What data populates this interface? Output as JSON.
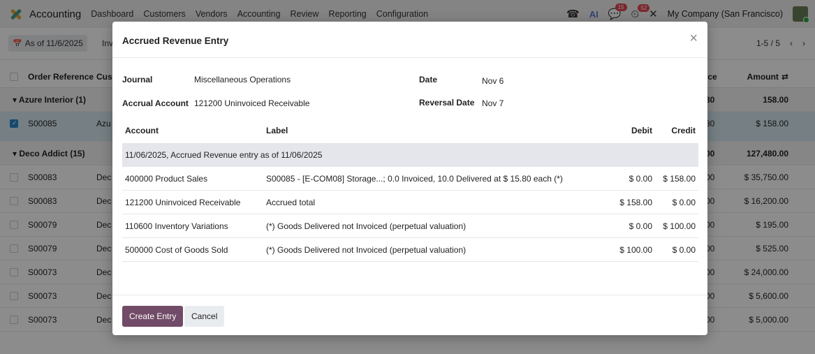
{
  "navbar": {
    "app_name": "Accounting",
    "menu": [
      "Dashboard",
      "Customers",
      "Vendors",
      "Accounting",
      "Review",
      "Reporting",
      "Configuration"
    ],
    "messages_badge": "15",
    "activity_badge": "52",
    "company": "My Company (San Francisco)"
  },
  "control": {
    "filter_label": "As of 11/6/2025",
    "inv_text": "Inv",
    "pager": "1-5 / 5"
  },
  "list": {
    "headers": {
      "order_reference": "Order Reference",
      "customer": "Cus",
      "price": "ice",
      "amount": "Amount"
    },
    "rows": [
      {
        "type": "group",
        "label": "Azure Interior (1)",
        "right": "80",
        "amount": "158.00"
      },
      {
        "type": "record",
        "ref": "S00085",
        "cust": "Azu",
        "right": "80",
        "amount": "$ 158.00",
        "selected": true
      },
      {
        "type": "group",
        "label": "Deco Addict (15)",
        "right": "00",
        "amount": "127,480.00"
      },
      {
        "type": "record",
        "ref": "S00083",
        "cust": "Dec",
        "right": "00",
        "amount": "$ 35,750.00"
      },
      {
        "type": "record",
        "ref": "S00083",
        "cust": "Dec",
        "right": "00",
        "amount": "$ 16,200.00"
      },
      {
        "type": "record",
        "ref": "S00079",
        "cust": "Dec",
        "right": "00",
        "amount": "$ 195.00"
      },
      {
        "type": "record",
        "ref": "S00079",
        "cust": "Dec",
        "right": "00",
        "amount": "$ 525.00"
      },
      {
        "type": "record",
        "ref": "S00073",
        "cust": "Dec",
        "right": "00",
        "amount": "$ 24,000.00"
      },
      {
        "type": "record",
        "ref": "S00073",
        "cust": "Dec",
        "right": "00",
        "amount": "$ 5,600.00"
      },
      {
        "type": "record",
        "ref": "S00073",
        "cust": "Dec",
        "right": "00",
        "amount": "$ 5,000.00"
      }
    ]
  },
  "dialog": {
    "title": "Accrued Revenue Entry",
    "close_glyph": "×",
    "fields": {
      "journal_label": "Journal",
      "journal_value": "Miscellaneous Operations",
      "accrual_label": "Accrual Account",
      "accrual_value": "121200 Uninvoiced Receivable",
      "date_label": "Date",
      "date_value": "Nov 6",
      "reversal_label": "Reversal Date",
      "reversal_value": "Nov 7"
    },
    "columns": {
      "account": "Account",
      "label": "Label",
      "debit": "Debit",
      "credit": "Credit"
    },
    "section": "11/06/2025, Accrued Revenue entry as of 11/06/2025",
    "lines": [
      {
        "account": "400000 Product Sales",
        "label": "S00085 - [E-COM08] Storage...; 0.0 Invoiced, 10.0 Delivered at $ 15.80 each (*)",
        "debit": "$ 0.00",
        "credit": "$ 158.00"
      },
      {
        "account": "121200 Uninvoiced Receivable",
        "label": "Accrued total",
        "debit": "$ 158.00",
        "credit": "$ 0.00"
      },
      {
        "account": "110600 Inventory Variations",
        "label": "(*) Goods Delivered not Invoiced (perpetual valuation)",
        "debit": "$ 0.00",
        "credit": "$ 100.00"
      },
      {
        "account": "500000 Cost of Goods Sold",
        "label": "(*) Goods Delivered not Invoiced (perpetual valuation)",
        "debit": "$ 100.00",
        "credit": "$ 0.00"
      }
    ],
    "buttons": {
      "create": "Create Entry",
      "cancel": "Cancel"
    }
  }
}
